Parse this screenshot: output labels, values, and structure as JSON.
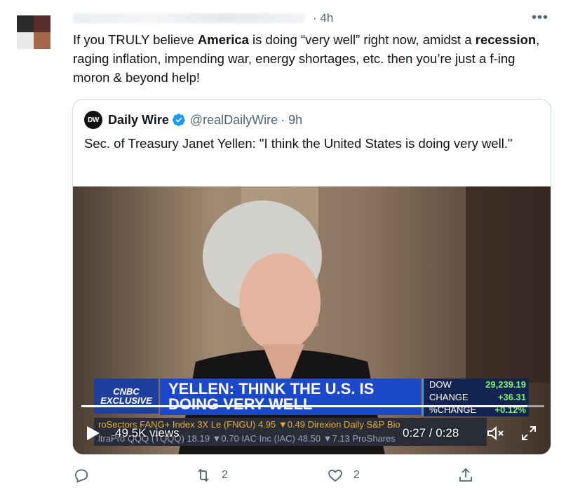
{
  "tweet": {
    "time": "· 4h",
    "more_icon": "more-horizontal-icon",
    "text_parts": [
      {
        "t": "If you TRULY believe ",
        "b": false
      },
      {
        "t": "America",
        "b": true
      },
      {
        "t": " is doing “very well” right now, amidst a ",
        "b": false
      },
      {
        "t": "recession",
        "b": true
      },
      {
        "t": ", raging inflation, impending war, energy shortages, etc. then you’re just a f-ing moron & beyond help!",
        "b": false
      }
    ]
  },
  "quote": {
    "logo_text": "DW",
    "name": "Daily Wire",
    "handle": "@realDailyWire",
    "time": "· 9h",
    "text": "Sec. of Treasury Janet Yellen: \"I think the United States is doing very well.\"",
    "video": {
      "cnbc_label": "CNBC EXCLUSIVE",
      "headline": "YELLEN: THINK THE U.S. IS DOING VERY WELL",
      "ticker_rows": [
        {
          "label": "DOW",
          "value": "29,239.19"
        },
        {
          "label": "CHANGE",
          "value": "+36.31"
        },
        {
          "label": "%CHANGE",
          "value": "+0.12%"
        }
      ],
      "ticker_line1": "roSectors FANG+ Index 3X Le (FNGU) 4.95 ▼0.49   Direxion Daily S&P Bio",
      "ticker_line2": "ltraPro QQQ (TQQQ) 18.19 ▼0.70   IAC Inc (IAC) 48.50 ▼7.13   ProShares",
      "views": "49.5K views",
      "time": "0:27 / 0:28",
      "progress": 0.964
    }
  },
  "actions": {
    "reply_count": "",
    "retweet_count": "2",
    "like_count": "2"
  },
  "colors": {
    "accent": "#1d9bf0",
    "text": "#0f1419",
    "secondary": "#536471"
  }
}
